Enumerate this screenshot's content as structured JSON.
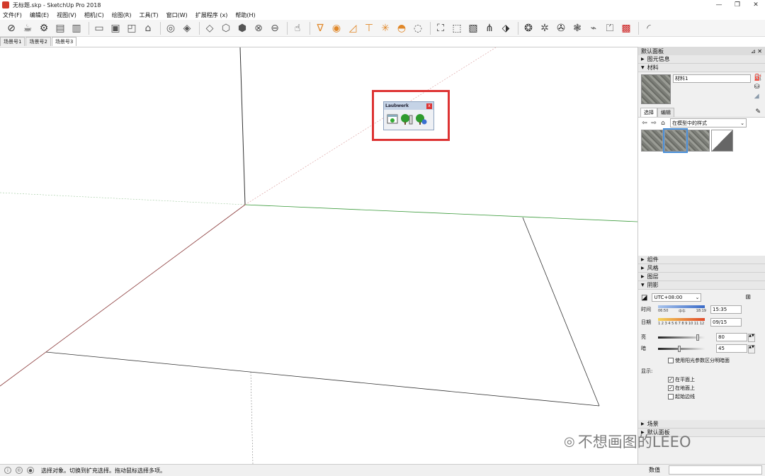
{
  "window": {
    "title": "无标题.skp - SketchUp Pro 2018",
    "controls": [
      "—",
      "❐",
      "✕"
    ]
  },
  "menu": [
    "文件(F)",
    "编辑(E)",
    "视图(V)",
    "相机(C)",
    "绘图(R)",
    "工具(T)",
    "窗口(W)",
    "扩展程序 (x)",
    "帮助(H)"
  ],
  "scene_tabs": [
    "场景号1",
    "场景号2",
    "场景号3"
  ],
  "laubwerk": {
    "title": "Laubwerk",
    "close": "x"
  },
  "tray": {
    "title": "默认面板",
    "pin": "⊿ ✕",
    "entity_info": "图元信息",
    "materials": "材料",
    "material_name": "材料1",
    "tab_select": "选择",
    "tab_edit": "编辑",
    "collection": "在模型中的样式",
    "components": "组件",
    "styles": "风格",
    "layers": "图层",
    "shadows": "阴影",
    "scenes": "场景",
    "instructor": "默认面板"
  },
  "shadows": {
    "timezone": "UTC+08:00",
    "time_label": "时间",
    "date_label": "日期",
    "time_start": "06:50",
    "time_mid": "中午",
    "time_end": "18:19",
    "months": "1 2 3 4 5 6 7 8 9 10 11 12",
    "time_value": "15:35",
    "date_value": "09/15",
    "light_label": "亮",
    "light_value": "80",
    "dark_label": "暗",
    "dark_value": "45",
    "use_sun": "使用阳光参数区分明暗面",
    "display_label": "显示:",
    "on_faces": "在平面上",
    "on_ground": "在地面上",
    "from_edges": "起始边线"
  },
  "status": {
    "text": "选择对象。切换到扩充选择。拖动鼠标选择多项。",
    "measure_label": "数值"
  },
  "watermark": "不想画图的LEEO"
}
